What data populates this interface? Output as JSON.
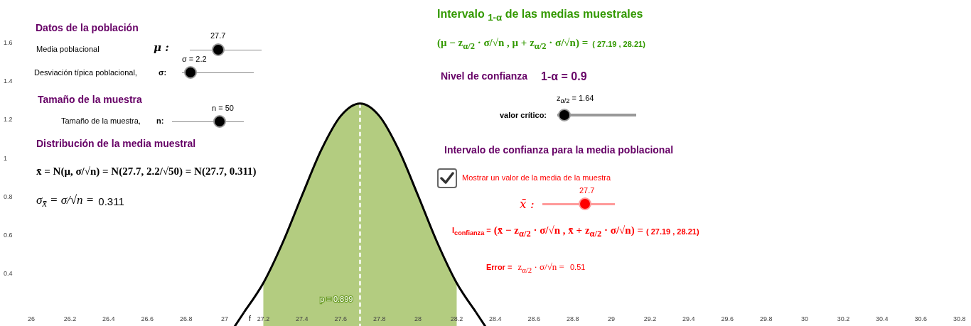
{
  "population": {
    "heading": "Datos de la población",
    "sliders": [
      {
        "label": "Media poblacional",
        "symbol": "μ :",
        "value": "27.7",
        "level": 0.4
      },
      {
        "label": "Desviación típica poblacional,",
        "symbol": "σ:",
        "value": "σ = 2.2",
        "level": 0.12
      }
    ]
  },
  "sample": {
    "heading": "Tamaño de la muestra",
    "slider": {
      "label": "Tamaño de la muestra,",
      "symbol": "n:",
      "value": "n = 50",
      "level": 0.66
    }
  },
  "distribution": {
    "heading": "Distribución de la media muestral",
    "formula": "x̄ = N(μ, σ/√n) = N(27.7, 2.2/√50) = N(27.7, 0.311)",
    "sd_formula": "σ$_{x̄}$ = σ/√n =",
    "sd_value": "0.311"
  },
  "interval_means": {
    "heading": "Intervalo $_{1-α}$ de las medias muestrales",
    "formula": "(μ − z$_{α/2}$ · σ/√n , μ + z$_{α/2}$ · σ/√n) =",
    "result": "( 27.19 , 28.21)"
  },
  "confidence": {
    "heading": "Nivel de confianza",
    "value": "1-α = 0.9",
    "slider": {
      "label": "valor crítico:",
      "value": "z$_{α/2}$ = 1.64",
      "level": 0.09
    }
  },
  "ci": {
    "heading": "Intervalo de confianza para la media poblacional",
    "checkbox": {
      "label": "Mostrar un valor de la media de la muestra",
      "checked": true
    },
    "slider": {
      "symbol": "x̄ :",
      "value": "27.7",
      "level": 0.59
    },
    "interval_label": "I$_{confianza}$ =",
    "formula": "(x̄ − z$_{α/2}$ · σ/√n , x̄ + z$_{α/2}$ · σ/√n) =",
    "result": "( 27.19 , 28.21)",
    "error_label": "Error =",
    "error_formula": "z$_{α/2}$ · σ/√n =",
    "error_value": "0.51"
  },
  "graph": {
    "chart_data": {
      "type": "line",
      "x": [
        27.1,
        27.2,
        27.3,
        27.4,
        27.5,
        27.6,
        27.7,
        27.8,
        27.9,
        28,
        28.1,
        28.2,
        28.3
      ],
      "series": [
        {
          "name": "f",
          "color": "#000000",
          "values": [
            0.2,
            0.352,
            0.561,
            0.806,
            1.043,
            1.218,
            1.283,
            1.218,
            1.043,
            0.806,
            0.561,
            0.352,
            0.2
          ]
        }
      ],
      "xlim": [
        25.838,
        30.86
      ],
      "ylim": [
        0.129,
        1.82
      ],
      "xticks": [
        26,
        26.2,
        26.4,
        26.6,
        26.8,
        27,
        27.2,
        27.4,
        27.6,
        27.8,
        28,
        28.2,
        28.4,
        28.6,
        28.8,
        29,
        29.2,
        29.4,
        29.6,
        29.8,
        30,
        30.2,
        30.4,
        30.6,
        30.8
      ],
      "yticks": [
        0.4,
        0.6,
        0.8,
        1,
        1.2,
        1.4,
        1.6
      ],
      "annotations": [
        {
          "text": "p = 0.899"
        }
      ],
      "ref_lines": [
        {
          "axis": "x",
          "value": 27.7,
          "color": "#ffffff"
        }
      ]
    }
  }
}
